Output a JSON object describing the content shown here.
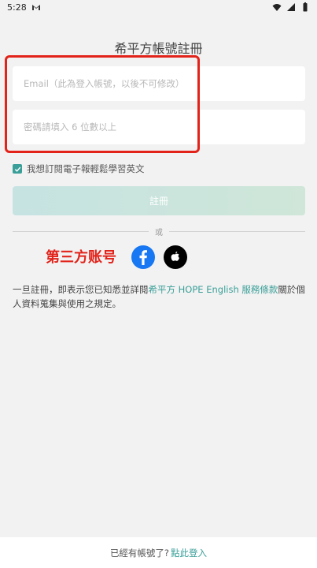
{
  "status_bar": {
    "time": "5:28",
    "mail_icon": "gmail-icon",
    "wifi_icon": "wifi-icon",
    "signal_icon": "signal-icon",
    "battery_icon": "battery-icon"
  },
  "page": {
    "title": "希平方帳號註冊"
  },
  "form": {
    "email_placeholder": "Email（此為登入帳號，以後不可修改）",
    "password_placeholder": "密碼請填入 6 位數以上",
    "newsletter_label": "我想訂閱電子報輕鬆學習英文",
    "newsletter_checked": true,
    "register_label": "註冊"
  },
  "divider": {
    "text": "或"
  },
  "third_party": {
    "label": "第三方账号",
    "facebook_icon": "facebook-icon",
    "apple_icon": "apple-icon"
  },
  "terms": {
    "prefix": "一旦註冊，即表示您已知悉並詳閱",
    "link1": "希平方 HOPE English 服務條款",
    "suffix": "關於個人資料蒐集與使用之規定。"
  },
  "footer": {
    "prompt": "已經有帳號了?",
    "login_link": "點此登入"
  },
  "colors": {
    "accent": "#3a9f98",
    "annotation": "#e2231a",
    "facebook": "#1877f2"
  }
}
